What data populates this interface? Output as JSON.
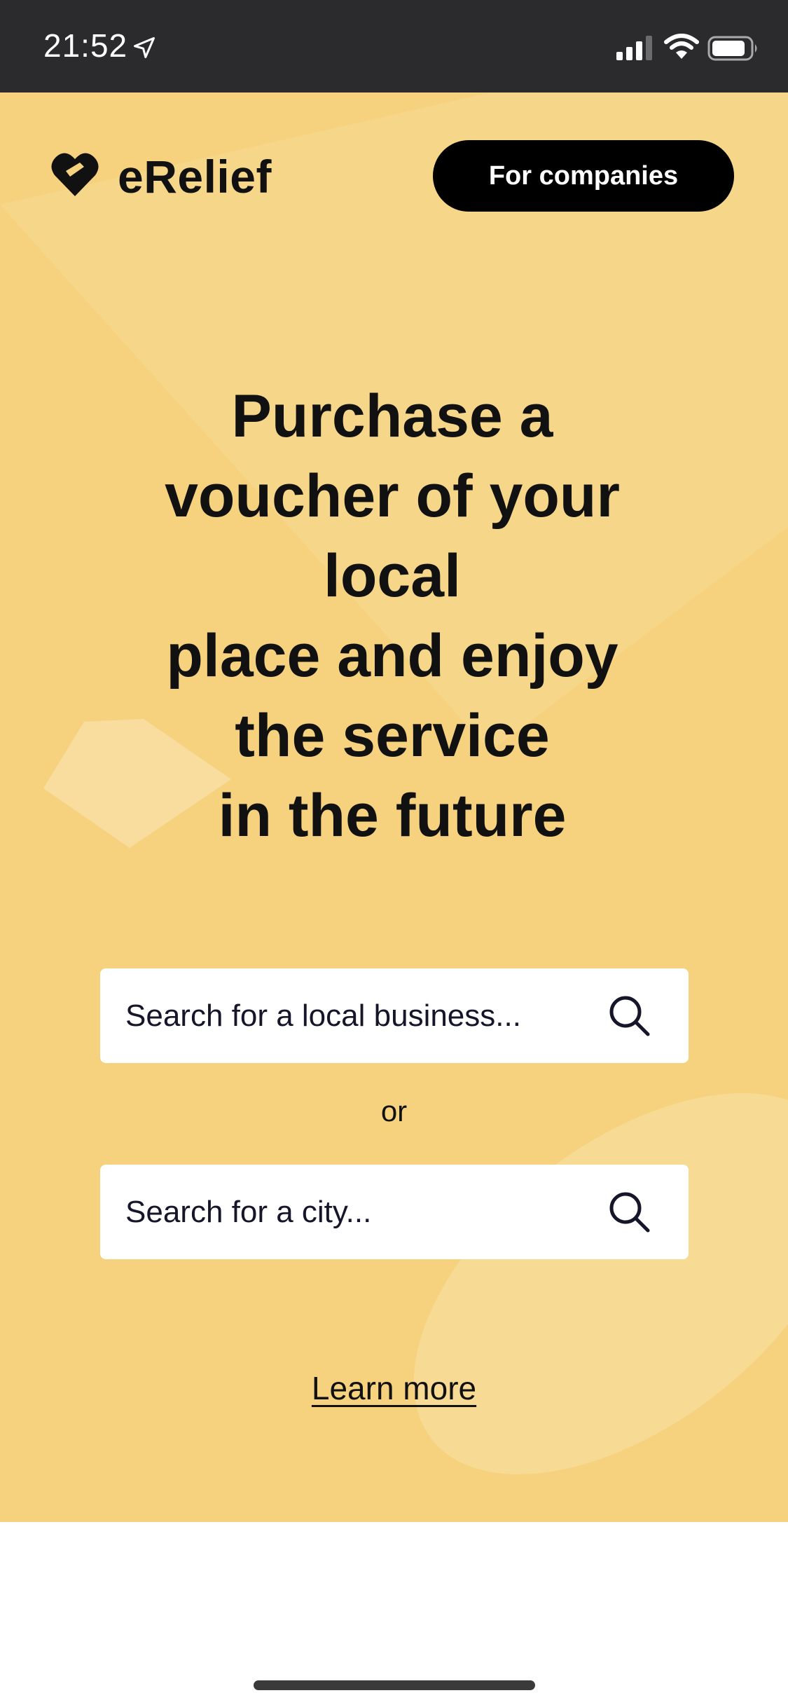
{
  "status_bar": {
    "time": "21:52",
    "icons": [
      "location-arrow-icon",
      "cellular-signal-icon",
      "wifi-icon",
      "battery-icon"
    ]
  },
  "header": {
    "logo_icon": "heart-logo-icon",
    "logo_text": "eRelief",
    "companies_button": "For companies"
  },
  "hero": {
    "headline_lines": [
      "Purchase a",
      "voucher of your",
      "local",
      "place and enjoy",
      "the service",
      "in the future"
    ],
    "search_business_placeholder": "Search for a local business...",
    "or_label": "or",
    "search_city_placeholder": "Search for a city...",
    "learn_more": "Learn more"
  },
  "colors": {
    "hero_background": "#f6d27e",
    "status_bar": "#2b2b2d",
    "button_background": "#000000",
    "text": "#111111"
  }
}
